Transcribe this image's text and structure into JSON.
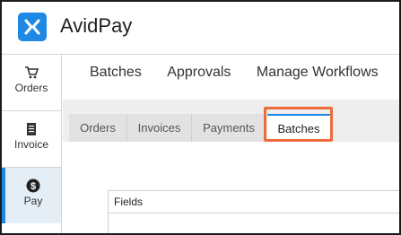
{
  "app": {
    "title": "AvidPay",
    "logo_color": "#1e88e5"
  },
  "leftnav": {
    "items": [
      {
        "label": "Orders",
        "icon": "cart-icon",
        "active": false
      },
      {
        "label": "Invoice",
        "icon": "document-icon",
        "active": false
      },
      {
        "label": "Pay",
        "icon": "dollar-icon",
        "active": true
      }
    ]
  },
  "topmenu": {
    "items": [
      {
        "label": "Batches"
      },
      {
        "label": "Approvals"
      },
      {
        "label": "Manage Workflows"
      }
    ]
  },
  "tabs": [
    {
      "label": "Orders",
      "active": false
    },
    {
      "label": "Invoices",
      "active": false
    },
    {
      "label": "Payments",
      "active": false
    },
    {
      "label": "Batches",
      "active": true
    }
  ],
  "content": {
    "fields_label": "Fields"
  },
  "colors": {
    "accent": "#1e88e5",
    "highlight": "#f06b3c"
  }
}
